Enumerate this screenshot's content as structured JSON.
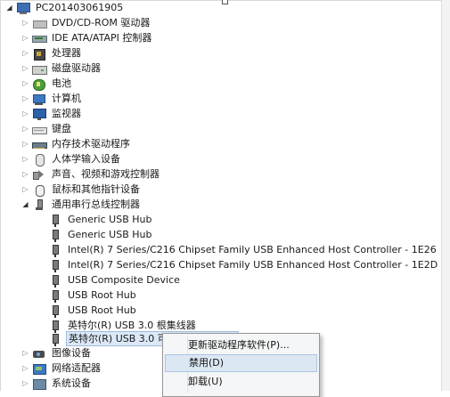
{
  "root": {
    "label": "PC201403061905",
    "icon": "computer-icon"
  },
  "categories": [
    {
      "label": "DVD/CD-ROM 驱动器",
      "icon": "disc-drive-icon"
    },
    {
      "label": "IDE ATA/ATAPI 控制器",
      "icon": "ide-controller-icon"
    },
    {
      "label": "处理器",
      "icon": "processor-icon"
    },
    {
      "label": "磁盘驱动器",
      "icon": "disk-drive-icon"
    },
    {
      "label": "电池",
      "icon": "battery-icon"
    },
    {
      "label": "计算机",
      "icon": "computer-icon"
    },
    {
      "label": "监视器",
      "icon": "monitor-icon"
    },
    {
      "label": "键盘",
      "icon": "keyboard-icon"
    },
    {
      "label": "内存技术驱动程序",
      "icon": "memory-icon"
    },
    {
      "label": "人体学输入设备",
      "icon": "hid-icon"
    },
    {
      "label": "声音、视频和游戏控制器",
      "icon": "audio-icon"
    },
    {
      "label": "鼠标和其他指针设备",
      "icon": "mouse-icon"
    }
  ],
  "usb_category": {
    "label": "通用串行总线控制器",
    "icon": "usb-icon",
    "children": [
      {
        "label": "Generic USB Hub"
      },
      {
        "label": "Generic USB Hub"
      },
      {
        "label": "Intel(R) 7 Series/C216 Chipset Family USB Enhanced Host Controller - 1E26"
      },
      {
        "label": "Intel(R) 7 Series/C216 Chipset Family USB Enhanced Host Controller - 1E2D"
      },
      {
        "label": "USB Composite Device"
      },
      {
        "label": "USB Root Hub"
      },
      {
        "label": "USB Root Hub"
      },
      {
        "label": "英特尔(R) USB 3.0 根集线器"
      },
      {
        "label": "英特尔(R) USB 3.0 可扩展主机控制器",
        "selected": true
      }
    ]
  },
  "after_categories": [
    {
      "label": "图像设备",
      "icon": "camera-icon"
    },
    {
      "label": "网络适配器",
      "icon": "network-adapter-icon"
    },
    {
      "label": "系统设备",
      "icon": "system-device-icon"
    }
  ],
  "context_menu": {
    "items": [
      {
        "label": "更新驱动程序软件(P)..."
      },
      {
        "label": "禁用(D)",
        "highlighted": true
      },
      {
        "label": "卸载(U)"
      }
    ]
  },
  "colors": {
    "selection_bg": "#dbe8f7",
    "menu_highlight": "#dce7f4",
    "menu_bg": "#f5f6f7"
  }
}
